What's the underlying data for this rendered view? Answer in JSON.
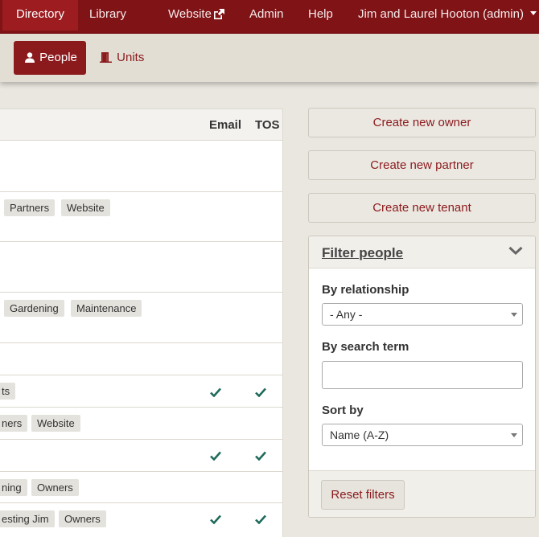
{
  "topnav": {
    "items": [
      {
        "label": "Directory",
        "icon": null
      },
      {
        "label": "Library",
        "icon": null
      },
      {
        "label": "Website",
        "icon": "external-link-icon"
      },
      {
        "label": "Admin",
        "icon": null
      },
      {
        "label": "Help",
        "icon": null
      },
      {
        "label": "Jim and Laurel Hooton (admin)",
        "icon": "caret-down-icon"
      }
    ],
    "active": "Directory"
  },
  "subnav": {
    "people_label": "People",
    "units_label": "Units"
  },
  "table": {
    "headers": {
      "email": "Email",
      "tos": "TOS"
    },
    "rows": [
      {
        "tags": [],
        "email": false,
        "tos": false
      },
      {
        "tags": [
          "Partners",
          "Website"
        ],
        "email": false,
        "tos": false
      },
      {
        "tags": [],
        "email": false,
        "tos": false
      },
      {
        "tags": [
          "Gardening",
          "Maintenance"
        ],
        "email": false,
        "tos": false
      },
      {
        "tags": [],
        "email": false,
        "tos": false
      },
      {
        "tags": [
          "ts"
        ],
        "email": true,
        "tos": true
      },
      {
        "tags": [
          "ners",
          "Website"
        ],
        "email": false,
        "tos": false
      },
      {
        "tags": [],
        "email": true,
        "tos": true
      },
      {
        "tags": [
          "ning",
          "Owners"
        ],
        "email": false,
        "tos": false
      },
      {
        "tags": [
          "esting Jim",
          "Owners"
        ],
        "email": true,
        "tos": true
      }
    ]
  },
  "actions": {
    "create_owner": "Create new owner",
    "create_partner": "Create new partner",
    "create_tenant": "Create new tenant"
  },
  "filter": {
    "title": "Filter people",
    "relationship_label": "By relationship",
    "relationship_value": "- Any -",
    "search_label": "By search term",
    "search_value": "",
    "sort_label": "Sort by",
    "sort_value": "Name (A-Z)",
    "reset_label": "Reset filters"
  },
  "colors": {
    "brand": "#7f1316",
    "accent": "#8b1a1d",
    "check": "#1f6b5c"
  }
}
